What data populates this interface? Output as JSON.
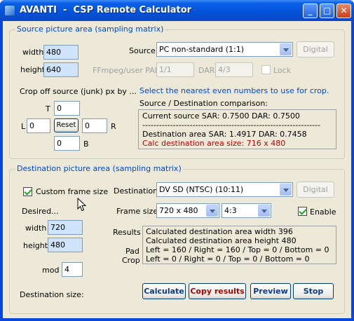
{
  "window": {
    "title": "AVANTI  -  CSP Remote Calculator",
    "min": "_",
    "max": "□",
    "close": "✕"
  },
  "source": {
    "group_title": "Source picture area (sampling matrix)",
    "width_label": "width",
    "width_value": "480",
    "height_label": "height",
    "height_value": "640",
    "source_label": "Source",
    "source_value": "PC non-standard (1:1)",
    "digital_label": "Digital",
    "par_label": "FFmpeg/user PAR",
    "par_value": "1/1",
    "dar_label": "DAR",
    "dar_value": "4/3",
    "lock_label": "Lock",
    "crop_label": "Crop off source (junk) px by ...",
    "hint": "Select the nearest even numbers to use for crop.",
    "t_label": "T",
    "t_value": "0",
    "l_label": "L",
    "l_value": "0",
    "reset_label": "Reset",
    "r_label": "R",
    "r_value": "0",
    "b_label": "B",
    "b_value": "0",
    "comparison_label": "Source / Destination comparison:",
    "comparison_lines": [
      "Current source   SAR: 0.7500  DAR: 0.7500",
      "----------------------------------------------------------------",
      "Destination area  SAR: 1.4917  DAR: 0.7458",
      "Calc destination area size:  716 x 480"
    ]
  },
  "destination": {
    "group_title": "Destination picture area (sampling matrix)",
    "custom_label": "Custom frame size",
    "desired_label": "Desired...",
    "width_label": "width",
    "width_value": "720",
    "height_label": "height",
    "height_value": "480",
    "mod_label": "mod",
    "mod_value": "4",
    "dest_label": "Destination",
    "dest_value": "DV SD (NTSC) (10:11)",
    "digital_label": "Digital",
    "frame_label": "Frame size",
    "frame_value": "720 x 480",
    "aspect_value": "4:3",
    "enable_label": "Enable",
    "results_label": "Results",
    "pad_label": "Pad",
    "crop_label": "Crop",
    "results_lines": [
      "Calculated destination area width  396",
      "Calculated destination area height 480",
      "Left = 160 / Right = 160 / Top = 0 / Bottom = 0",
      "Left = 0 / Right = 0 / Top = 0 / Bottom = 0"
    ],
    "dest_size_label": "Destination size:",
    "calculate_label": "Calculate",
    "copy_label": "Copy results",
    "preview_label": "Preview",
    "stop_label": "Stop"
  },
  "colors": {
    "accent": "#0046d5",
    "highlight": "#cfe3fb",
    "warning": "#c00000"
  },
  "icons": {
    "cursor": "mouse-pointer-icon",
    "app": "app-icon"
  }
}
